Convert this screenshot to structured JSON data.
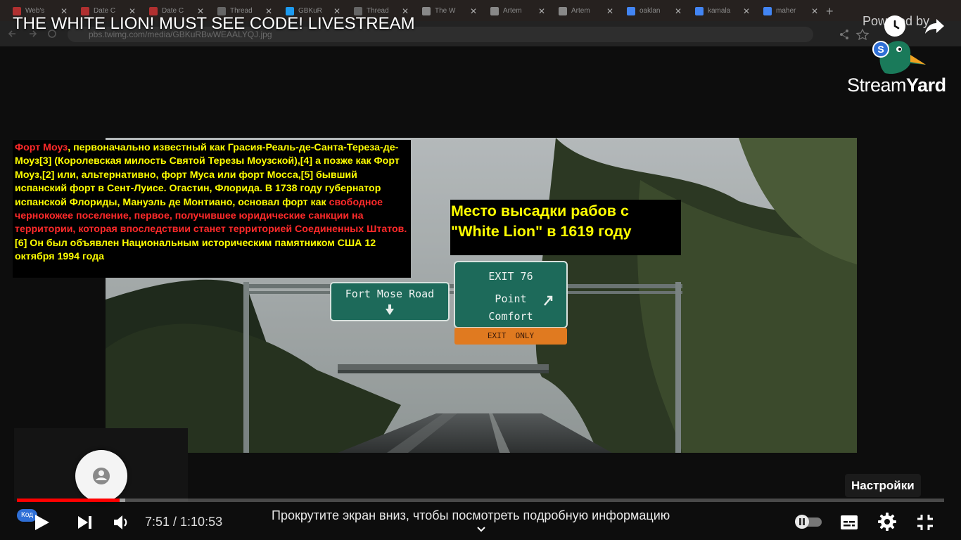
{
  "browser_tabs": [
    {
      "label": "Web's ",
      "icon": "pin-icon"
    },
    {
      "label": "Date C",
      "icon": "pin-icon"
    },
    {
      "label": "Date C",
      "icon": "pin-icon"
    },
    {
      "label": "Thread",
      "icon": "threads-icon"
    },
    {
      "label": "GBKuR",
      "icon": "twitter-icon"
    },
    {
      "label": "Thread",
      "icon": "threads-icon"
    },
    {
      "label": "The W",
      "icon": "wiki-icon"
    },
    {
      "label": "Artem",
      "icon": "wiki-icon"
    },
    {
      "label": "Artem",
      "icon": "wiki-icon"
    },
    {
      "label": "oaklan",
      "icon": "google-icon"
    },
    {
      "label": "kamala",
      "icon": "google-icon"
    },
    {
      "label": "maher",
      "icon": "google-icon"
    }
  ],
  "browser_url": "pbs.twimg.com/media/GBKuRBwWEAALYQJ.jpg",
  "video": {
    "title": "THE WHITE LION! MUST SEE CODE! LIVESTREAM",
    "powered_by": "Powered by",
    "brand_light": "Stream",
    "brand_bold": "Yard",
    "brand_color": "#1a7a5a"
  },
  "overlay": {
    "info_parts": [
      {
        "text": "Форт Моуз",
        "color": "red"
      },
      {
        "text": ", первоначально известный как Грасия-Реаль-де-Санта-Тереза-де-Моуз[3] (Королевская милость Святой Терезы Моузской),[4] а позже как Форт Моуз,[2] или, альтернативно, форт Муса или форт Мосса,[5] бывший испанский форт в Сент-Луисе. Огастин, Флорида. В 1738 году губернатор испанской Флориды, Мануэль де Монтиано, основал форт как ",
        "color": "yellow"
      },
      {
        "text": "свободное чернокожее поселение, первое, получившее юридические санкции на территории, которая впоследствии станет территорией Соединенных Штатов.",
        "color": "red"
      },
      {
        "text": "[6] Он был объявлен Национальным историческим памятником США 12 октября 1994 года",
        "color": "yellow"
      }
    ],
    "landing_text": "Место высадки рабов с \"White Lion\" в 1619 году"
  },
  "scene_signs": {
    "left_sign": "Fort Mose Road",
    "exit_number": "EXIT 76",
    "exit_dest_1": "Point",
    "exit_dest_2": "Comfort",
    "exit_only": "EXIT  ONLY"
  },
  "player": {
    "tooltip": "Настройки",
    "time_display": "7:51 / 1:10:53",
    "played_fraction": 0.111,
    "buffered_fraction": 0.117,
    "scroll_hint": "Прокрутите экран вниз, чтобы посмотреть подробную информацию",
    "badge": "Код",
    "accent": "#ff0000"
  }
}
